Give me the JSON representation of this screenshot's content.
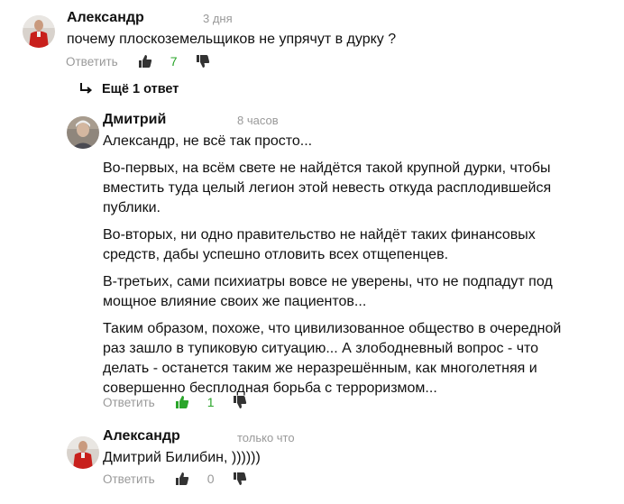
{
  "colors": {
    "like_active": "#2aa52a",
    "icon_inactive": "#333333",
    "muted_text": "#999999"
  },
  "comments": [
    {
      "author": "Александр",
      "time": "3 дня",
      "paragraphs": [
        "почему плоскоземельщиков не упрячут в дурку ?"
      ],
      "reply_label": "Ответить",
      "likes": "7",
      "liked": true
    },
    {
      "author": "Дмитрий",
      "time": "8 часов",
      "paragraphs": [
        "Александр, не всё так просто...",
        "Во-первых, на всём свете не найдётся такой крупной дурки, чтобы вместить туда целый легион этой невесть откуда расплодившейся публики.",
        "Во-вторых, ни одно правительство не найдёт таких финансовых средств, дабы успешно отловить всех отщепенцев.",
        "В-третьих, сами психиатры вовсе не уверены, что не подпадут под мощное влияние своих же пациентов...",
        "Таким образом, похоже, что цивилизованное общество в очередной раз зашло в тупиковую ситуацию... А злободневный вопрос - что делать - останется таким же неразрешённым, как многолетняя и совершенно бесплодная борьба с терроризмом..."
      ],
      "reply_label": "Ответить",
      "likes": "1",
      "liked": true
    },
    {
      "author": "Александр",
      "time": "только что",
      "paragraphs": [
        "Дмитрий Билибин, ))))))"
      ],
      "reply_label": "Ответить",
      "likes": "0",
      "liked": false
    }
  ],
  "more_replies": {
    "label": "Ещё 1 ответ",
    "icon": "reply-arrow-icon"
  }
}
